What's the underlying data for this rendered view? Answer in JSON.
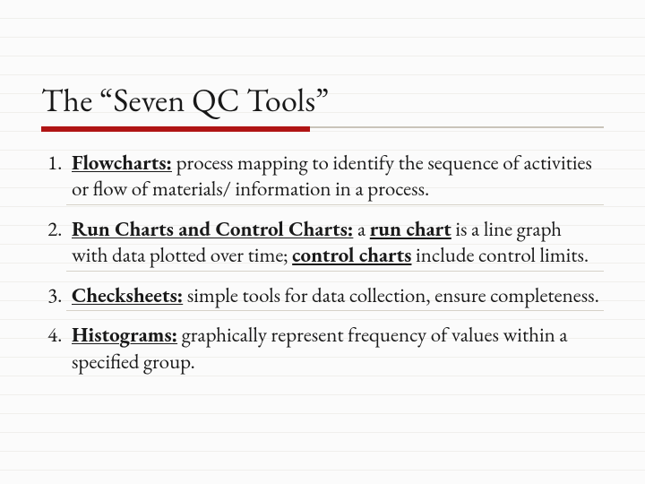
{
  "slide": {
    "title": "The “Seven QC Tools”",
    "items": [
      {
        "heading": "Flowcharts:",
        "body": "  process mapping to identify the sequence of activities or flow of materials/ information in a process."
      },
      {
        "heading": "Run Charts and Control Charts:",
        "lead": "  a ",
        "run_term": "run chart",
        "mid": " is a line graph with data plotted over time; ",
        "ctrl_term": "control charts",
        "tail": " include control limits."
      },
      {
        "heading": "Checksheets:",
        "body": "  simple tools for data collection, ensure completeness."
      },
      {
        "heading": "Histograms:",
        "body": "  graphically represent frequency of values within a specified group."
      }
    ]
  }
}
